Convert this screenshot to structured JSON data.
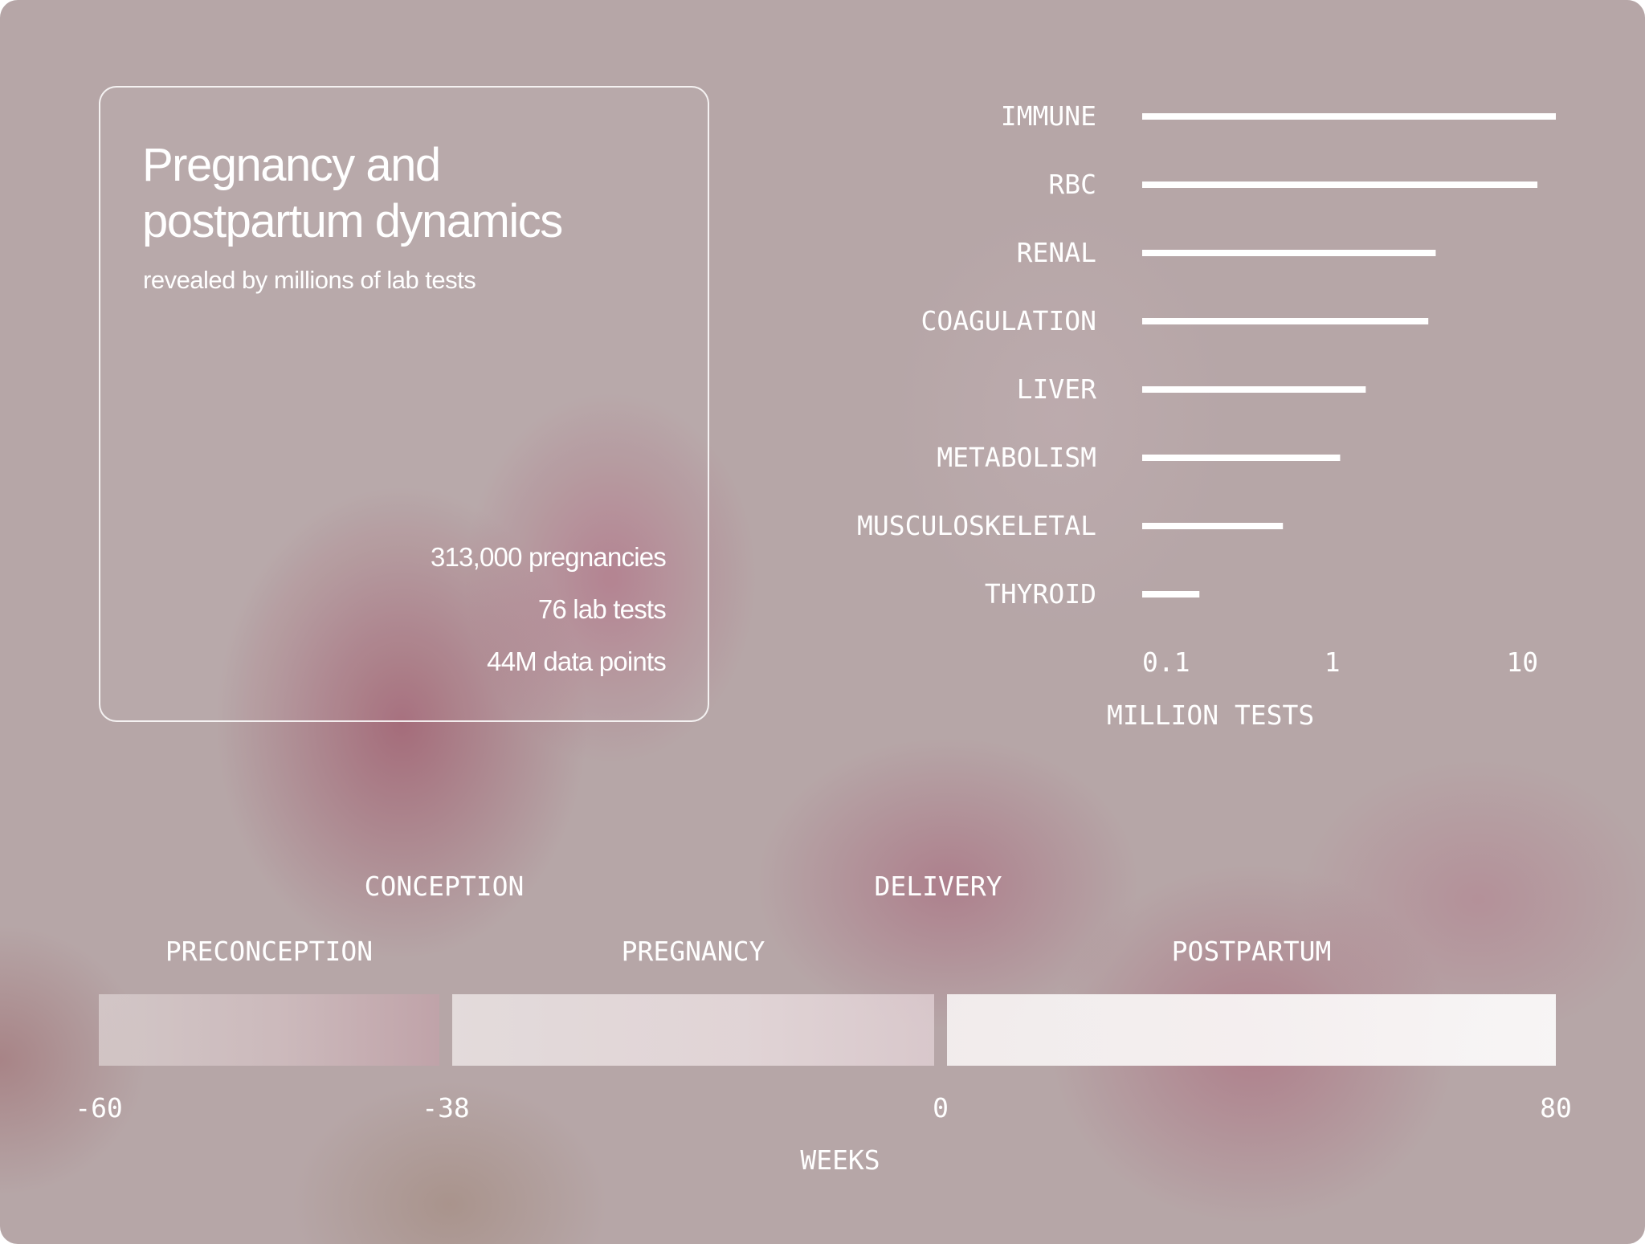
{
  "colors": {
    "background": "#b6a6a7",
    "text": "#ffffff",
    "bar": "#ffffff"
  },
  "info": {
    "title": "Pregnancy and postpartum dynamics",
    "subtitle": "revealed by millions of lab tests",
    "stats": [
      "313,000 pregnancies",
      "76 lab tests",
      "44M data points"
    ]
  },
  "chart_data": [
    {
      "type": "bar",
      "orientation": "horizontal",
      "categories": [
        "IMMUNE",
        "RBC",
        "RENAL",
        "COAGULATION",
        "LIVER",
        "METABOLISM",
        "MUSCULOSKELETAL",
        "THYROID"
      ],
      "values": [
        15,
        12,
        3.5,
        3.2,
        1.5,
        1.1,
        0.55,
        0.2
      ],
      "xscale": "log",
      "xlim": [
        0.1,
        15
      ],
      "xticks": [
        "0.1",
        "1",
        "10"
      ],
      "xtick_values": [
        0.1,
        1,
        10
      ],
      "xlabel": "MILLION TESTS",
      "ylabel": "",
      "title": ""
    },
    {
      "type": "timeline",
      "xlabel": "WEEKS",
      "ticks": [
        "-60",
        "-38",
        "0",
        "80"
      ],
      "tick_values": [
        -60,
        -38,
        0,
        80
      ],
      "segments": [
        {
          "label": "PRECONCEPTION",
          "start": -60,
          "end": -38
        },
        {
          "label": "PREGNANCY",
          "start": -38,
          "end": 0
        },
        {
          "label": "POSTPARTUM",
          "start": 0,
          "end": 80
        }
      ],
      "events": [
        {
          "label": "CONCEPTION",
          "at": -38
        },
        {
          "label": "DELIVERY",
          "at": 0
        }
      ]
    }
  ]
}
